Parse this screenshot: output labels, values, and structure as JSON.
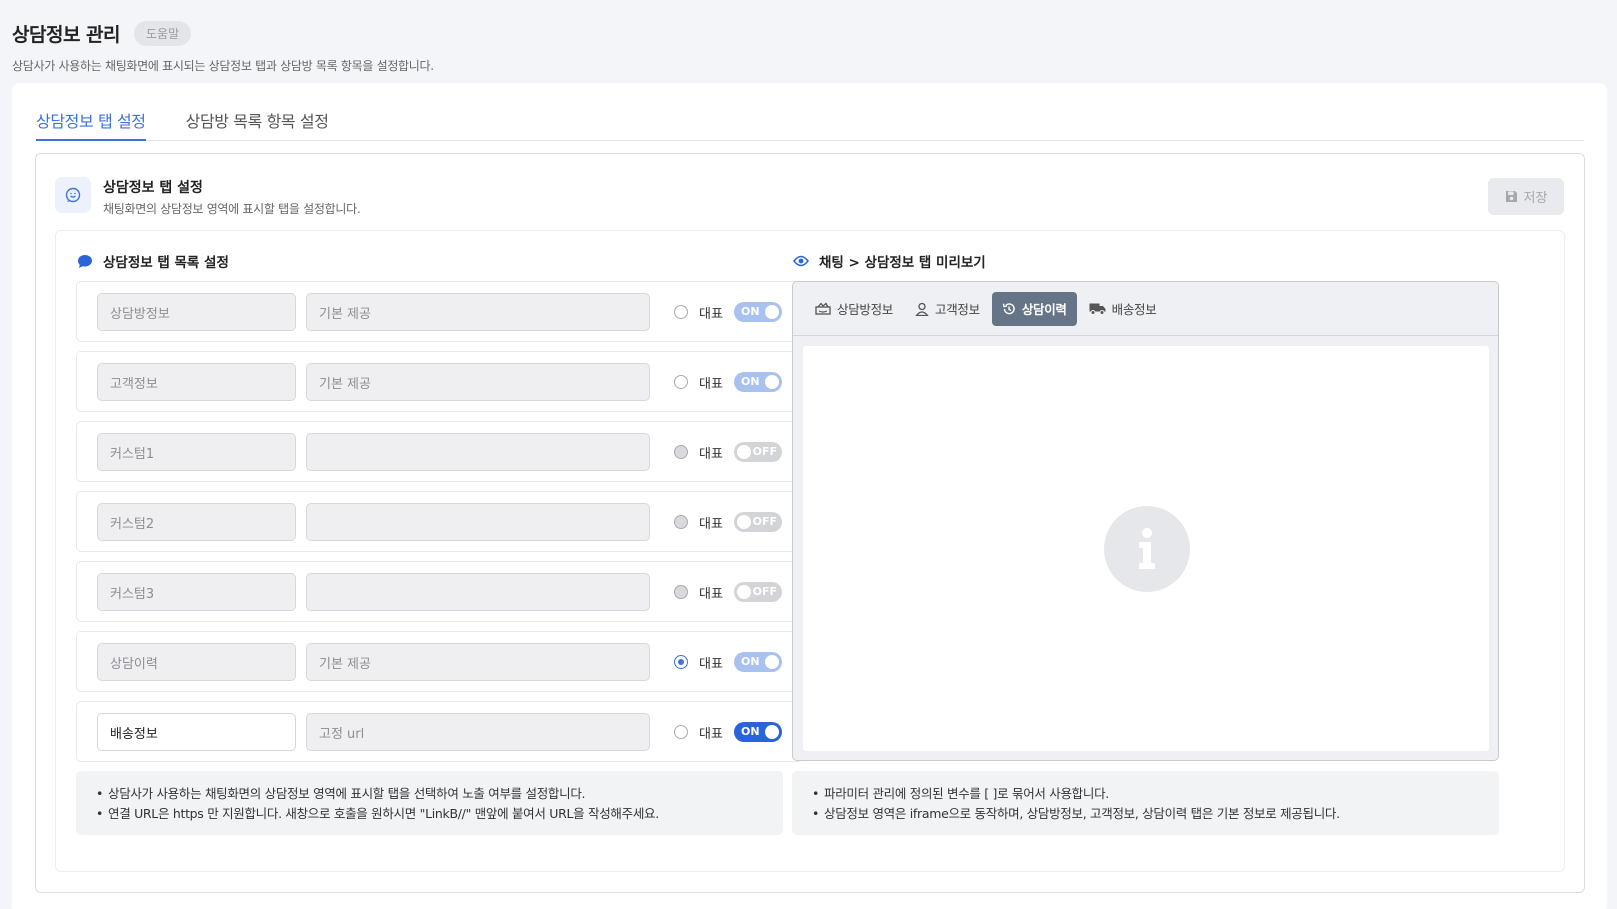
{
  "header": {
    "title": "상담정보 관리",
    "help_label": "도움말",
    "description": "상담사가 사용하는 채팅화면에 표시되는 상담정보 탭과 상담방 목록 항목을 설정합니다."
  },
  "tabs": [
    {
      "label": "상담정보 탭 설정",
      "active": true
    },
    {
      "label": "상담방 목록 항목 설정",
      "active": false
    }
  ],
  "section": {
    "title": "상담정보 탭 설정",
    "description": "채팅화면의 상담정보 영역에 표시할 탭을 설정합니다.",
    "save_label": "저장",
    "icon": "chat-smile-icon"
  },
  "tab_list": {
    "title": "상담정보 탭 목록 설정",
    "representative_label": "대표",
    "rows": [
      {
        "name": "상담방정보",
        "url": "기본 제공",
        "representative": false,
        "toggle": "ON",
        "editable": false
      },
      {
        "name": "고객정보",
        "url": "기본 제공",
        "representative": false,
        "toggle": "ON",
        "editable": false
      },
      {
        "name": "커스텀1",
        "url": "",
        "representative": false,
        "toggle": "OFF",
        "editable": false
      },
      {
        "name": "커스텀2",
        "url": "",
        "representative": false,
        "toggle": "OFF",
        "editable": false
      },
      {
        "name": "커스텀3",
        "url": "",
        "representative": false,
        "toggle": "OFF",
        "editable": false
      },
      {
        "name": "상담이력",
        "url": "기본 제공",
        "representative": true,
        "toggle": "ON",
        "editable": false
      },
      {
        "name": "배송정보",
        "url": "고정 url",
        "representative": false,
        "toggle": "ON",
        "editable": true
      }
    ],
    "notes": [
      "상담사가 사용하는 채팅화면의 상담정보 영역에 표시할 탭을 선택하여 노출 여부를 설정합니다.",
      "연결 URL은 https 만 지원합니다. 새창으로 호출을 원하시면 \"LinkB//\" 맨앞에 붙여서 URL을 작성해주세요."
    ]
  },
  "preview": {
    "title": "채팅 > 상담정보 탭 미리보기",
    "tabs": [
      {
        "label": "상담방정보",
        "icon": "room-icon",
        "active": false
      },
      {
        "label": "고객정보",
        "icon": "user-icon",
        "active": false
      },
      {
        "label": "상담이력",
        "icon": "history-icon",
        "active": true
      },
      {
        "label": "배송정보",
        "icon": "truck-icon",
        "active": false
      }
    ],
    "notes": [
      "파라미터 관리에 정의된 변수를 [ ]로 묶어서 사용합니다.",
      "상담정보 영역은 iframe으로 동작하며, 상담방정보, 고객정보, 상담이력 탭은 기본 정보로 제공됩니다."
    ]
  },
  "colors": {
    "accent": "#3f73d8",
    "toggle_on_light": "#a8c1ef",
    "toggle_on_strong": "#2a64d8",
    "toggle_off": "#d3d4d7",
    "preview_active_tab": "#667487"
  }
}
